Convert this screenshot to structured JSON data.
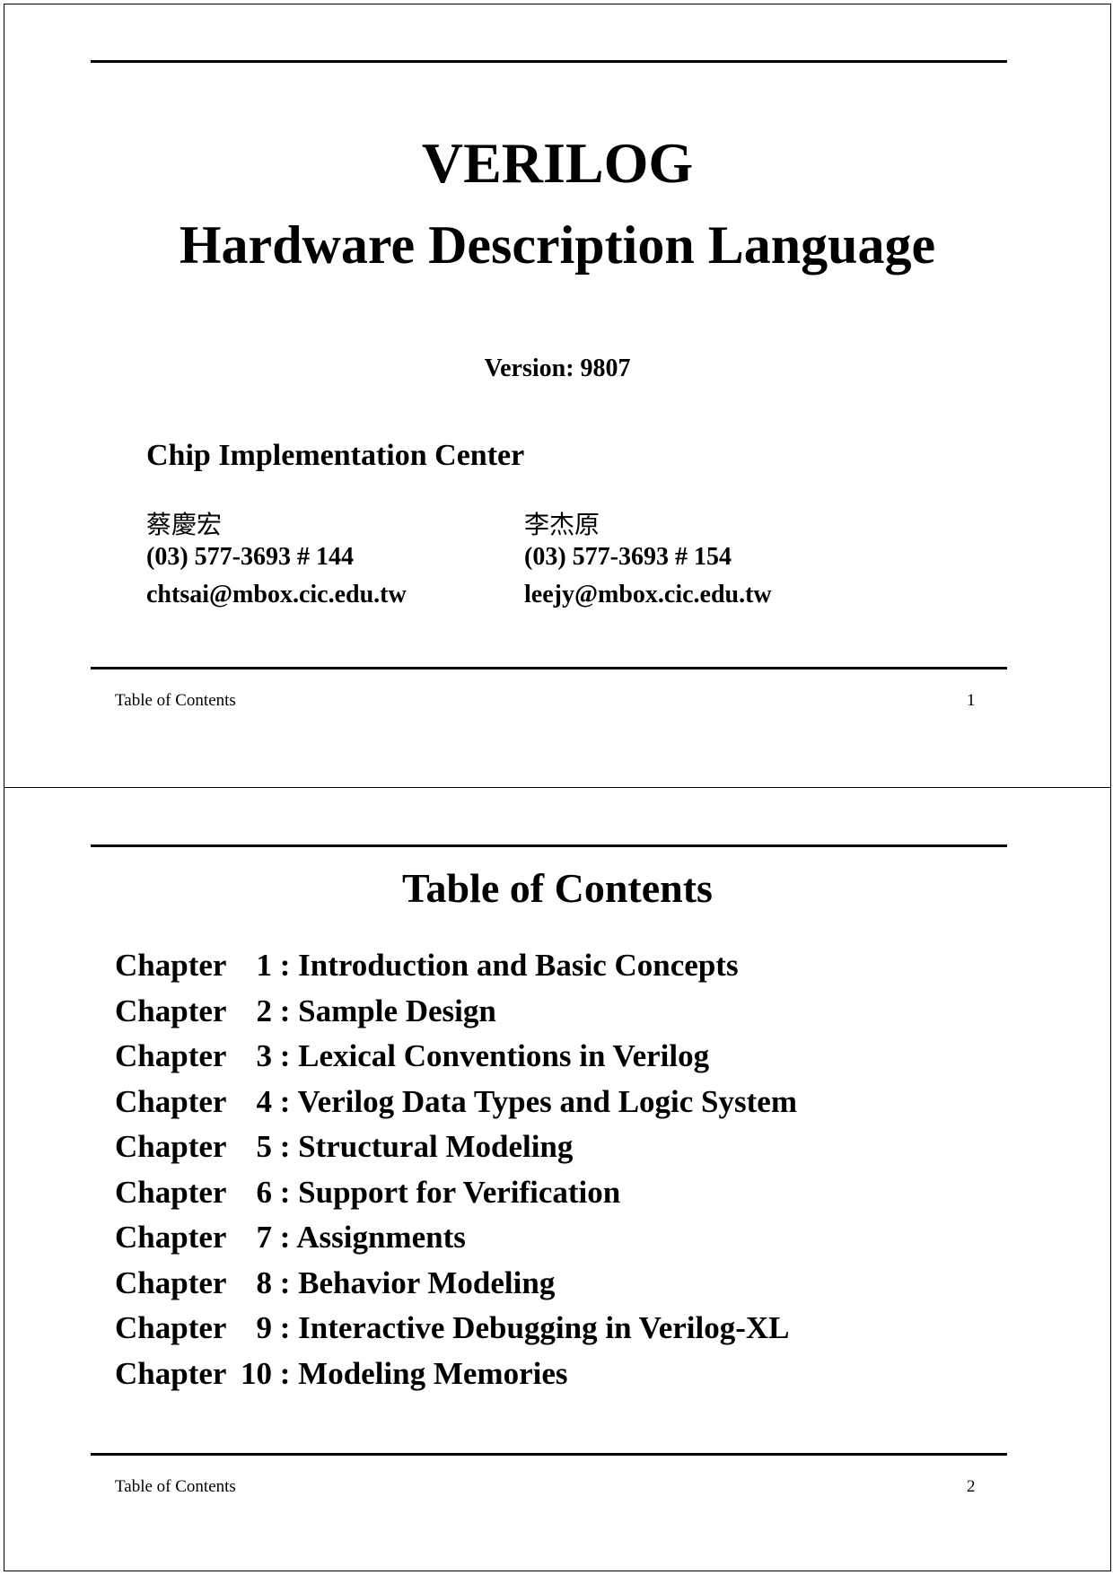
{
  "slides": [
    {
      "title": "VERILOG",
      "subtitle": "Hardware Description Language",
      "version": "Version: 9807",
      "organization": "Chip Implementation Center",
      "contacts": [
        {
          "name": "蔡慶宏",
          "phone": "(03) 577-3693 # 144",
          "email": "chtsai@mbox.cic.edu.tw"
        },
        {
          "name": "李杰原",
          "phone": "(03) 577-3693 # 154",
          "email": "leejy@mbox.cic.edu.tw"
        }
      ],
      "footer": {
        "label": "Table of Contents",
        "page": "1"
      }
    },
    {
      "title": "Table of Contents",
      "chapters": [
        {
          "word": "Chapter",
          "number": "1",
          "title": ": Introduction and Basic Concepts"
        },
        {
          "word": "Chapter",
          "number": "2",
          "title": ": Sample Design"
        },
        {
          "word": "Chapter",
          "number": "3",
          "title": ": Lexical Conventions in Verilog"
        },
        {
          "word": "Chapter",
          "number": "4",
          "title": ": Verilog Data Types and Logic System"
        },
        {
          "word": "Chapter",
          "number": "5",
          "title": ": Structural Modeling"
        },
        {
          "word": "Chapter",
          "number": "6",
          "title": ": Support for Verification"
        },
        {
          "word": "Chapter",
          "number": "7",
          "title": ": Assignments"
        },
        {
          "word": "Chapter",
          "number": "8",
          "title": ": Behavior Modeling"
        },
        {
          "word": "Chapter",
          "number": "9",
          "title": ": Interactive Debugging in Verilog-XL"
        },
        {
          "word": "Chapter",
          "number": "10",
          "title": ": Modeling Memories"
        }
      ],
      "footer": {
        "label": "Table of Contents",
        "page": "2"
      }
    }
  ]
}
